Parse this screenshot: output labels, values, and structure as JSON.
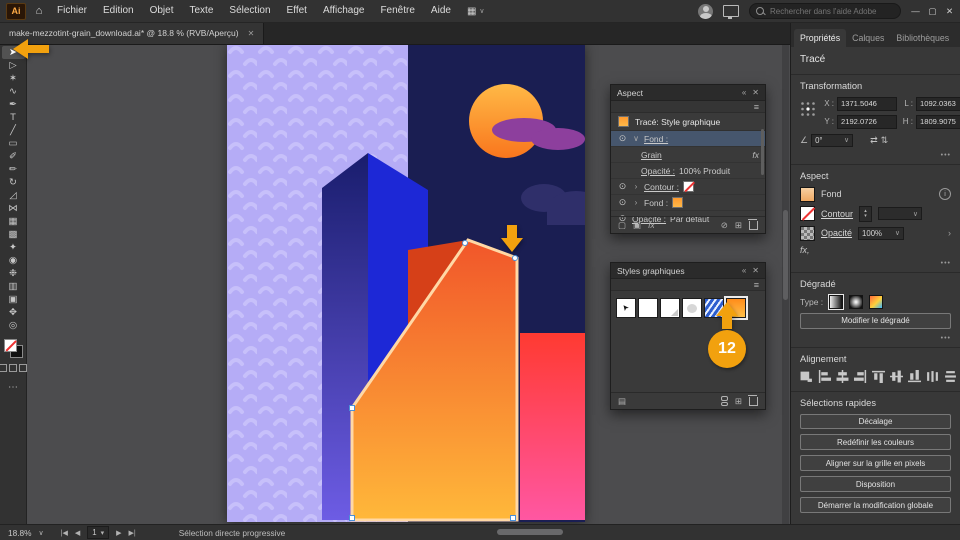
{
  "colors": {
    "accent": "#F2A10E"
  },
  "titlebar": {
    "logo": "Ai",
    "menus": [
      "Fichier",
      "Edition",
      "Objet",
      "Texte",
      "Sélection",
      "Effet",
      "Affichage",
      "Fenêtre",
      "Aide"
    ],
    "search_placeholder": "Rechercher dans l'aide Adobe"
  },
  "tabbar": {
    "doc_title": "make-mezzotint-grain_download.ai* @ 18.8 % (RVB/Aperçu)"
  },
  "tools": [
    {
      "glyph": "➤"
    },
    {
      "glyph": "▷"
    },
    {
      "glyph": "✶"
    },
    {
      "glyph": "∿"
    },
    {
      "glyph": "✒"
    },
    {
      "glyph": "T"
    },
    {
      "glyph": "╱"
    },
    {
      "glyph": "▭"
    },
    {
      "glyph": "✐"
    },
    {
      "glyph": "✏"
    },
    {
      "glyph": "↻"
    },
    {
      "glyph": "◿"
    },
    {
      "glyph": "⋈"
    },
    {
      "glyph": "▦"
    },
    {
      "glyph": "▩"
    },
    {
      "glyph": "✦"
    },
    {
      "glyph": "◉"
    },
    {
      "glyph": "❉"
    },
    {
      "glyph": "▥"
    },
    {
      "glyph": "▣"
    },
    {
      "glyph": "✥"
    },
    {
      "glyph": "◎"
    }
  ],
  "aspect_panel": {
    "title": "Aspect",
    "target": "Tracé: Style graphique",
    "rows": [
      {
        "label": "Fond :"
      },
      {
        "label": "Grain",
        "fx": "fx"
      },
      {
        "label": "Opacité :",
        "value": "100% Produit"
      },
      {
        "label": "Contour :"
      },
      {
        "label": "Fond :"
      },
      {
        "label": "Opacité :",
        "value": "Par défaut"
      }
    ]
  },
  "styles_panel": {
    "title": "Styles graphiques"
  },
  "properties": {
    "tabs": [
      "Propriétés",
      "Calques",
      "Bibliothèques"
    ],
    "selection_type": "Tracé",
    "transform": {
      "title": "Transformation",
      "x_label": "X :",
      "x": "1371.5046",
      "y_label": "Y :",
      "y": "2192.0726",
      "w_label": "L :",
      "w": "1092.0363",
      "h_label": "H :",
      "h": "1809.9075",
      "angle": "0°"
    },
    "aspect": {
      "title": "Aspect",
      "fill_label": "Fond",
      "stroke_label": "Contour",
      "opacity_label": "Opacité",
      "opacity_value": "100%",
      "fx_label": "fx,"
    },
    "gradient": {
      "title": "Dégradé",
      "type_label": "Type :",
      "edit_button": "Modifier le dégradé"
    },
    "align": {
      "title": "Alignement"
    },
    "quick": {
      "title": "Sélections rapides",
      "buttons": [
        "Décalage",
        "Redéfinir les couleurs",
        "Aligner sur la grille en pixels",
        "Disposition",
        "Démarrer la modification globale"
      ]
    }
  },
  "statusbar": {
    "zoom": "18.8%",
    "artboard": "1",
    "hint": "Sélection directe progressive"
  },
  "annotations": {
    "badge": "12"
  },
  "icons": {
    "home": "⌂",
    "workspace": "▦",
    "caret": "∨",
    "caret_down": "▾",
    "minimize": "—",
    "maximize": "▢",
    "close": "✕",
    "collapse": "«",
    "panel_menu": "≡",
    "eye": "⊙",
    "chevron_right": "›",
    "fx": "fx",
    "ellipsis": "•••",
    "none": "⊘",
    "new": "⊞",
    "square": "▢",
    "square2": "▣",
    "swap": "⇄",
    "flip_v": "⇅",
    "shear": "∠",
    "library": "▤",
    "first": "|◀",
    "prev": "◀",
    "next": "▶",
    "last": "▶|",
    "cursor": "➤",
    "info": "i",
    "tool_more": "⋯",
    "up": "▴",
    "down": "▾"
  },
  "artwork": {
    "lavender": "#b5acf6",
    "pattern": "#c7c0fa",
    "navy": "#1a1e52",
    "sun_top": "#ffb946",
    "sun_bottom": "#f9761d",
    "cloud_purple": "#8d3f9d",
    "cloud_dark": "#2f2f6a",
    "prism_top": "#191d6d",
    "prism_bottom": "#6d5ce4",
    "prism_face": "#1d28d6",
    "backdrop_red": "#d64018",
    "building_top": "#f1562a",
    "building_bottom": "#ffb83a",
    "building_stroke": "#ffd8a6",
    "pink_top": "#ff3a31",
    "pink_bottom": "#ff57a2",
    "anchor_stroke": "#4a90d9"
  }
}
